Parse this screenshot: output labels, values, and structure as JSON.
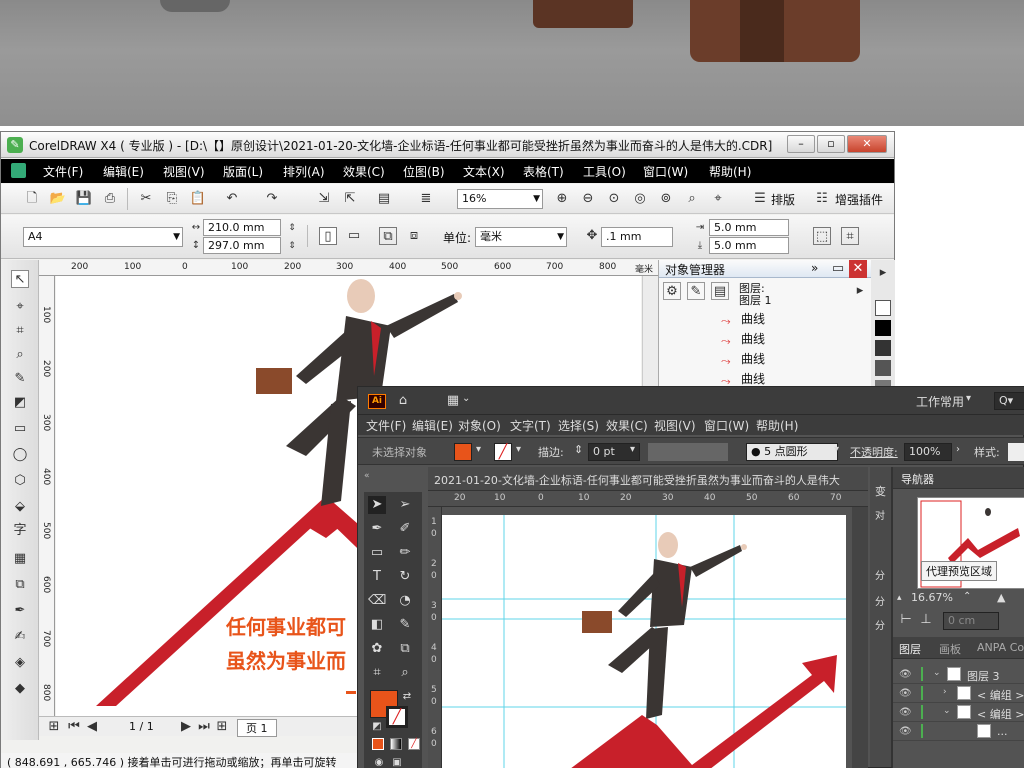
{
  "colors": {
    "brand_red": "#c8202a",
    "suit": "#3a3533",
    "skin": "#e8cbb8",
    "orange": "#e8541a",
    "ai_bg": "#535353",
    "guide": "#5fd4e8"
  },
  "corel": {
    "title": "CorelDRAW X4 ( 专业版 ) - [D:\\【】原创设计\\2021-01-20-文化墙-企业标语-任何事业都可能受挫折虽然为事业而奋斗的人是伟大的.CDR]",
    "menu": [
      "文件(F)",
      "编辑(E)",
      "视图(V)",
      "版面(L)",
      "排列(A)",
      "效果(C)",
      "位图(B)",
      "文本(X)",
      "表格(T)",
      "工具(O)",
      "窗口(W)",
      "帮助(H)"
    ],
    "zoom": "16%",
    "plugin_typeset": "排版",
    "plugin_enhance": "增强插件",
    "page_size": "A4",
    "width": "210.0 mm",
    "height": "297.0 mm",
    "unit_label": "单位:",
    "unit_value": "毫米",
    "nudge": ".1 mm",
    "dup_x": "5.0 mm",
    "dup_y": "5.0 mm",
    "hruler": [
      "200",
      "100",
      "0",
      "100",
      "200",
      "300",
      "400",
      "500",
      "600",
      "700",
      "800"
    ],
    "hruler_unit": "毫米",
    "vruler": [
      "100",
      "200",
      "300",
      "400",
      "500",
      "600",
      "700",
      "800"
    ],
    "page_counter": "1 / 1",
    "page_tab": "页 1",
    "status": "( 848.691 , 665.746 )    接着单击可进行拖动或缩放；再单击可旋转",
    "slogan_line1": "任何事业都可",
    "slogan_line2": "虽然为事业而",
    "objmgr": {
      "title": "对象管理器",
      "layer_line1": "图层:",
      "layer_line2": "图层 1",
      "items": [
        "曲线",
        "曲线",
        "曲线",
        "曲线"
      ]
    }
  },
  "ai": {
    "logo": "Ai",
    "workspace": "工作常用",
    "menu": [
      "文件(F)",
      "编辑(E)",
      "对象(O)",
      "文字(T)",
      "选择(S)",
      "效果(C)",
      "视图(V)",
      "窗口(W)",
      "帮助(H)"
    ],
    "no_selection": "未选择对象",
    "stroke_label": "描边:",
    "stroke_value": "0 pt",
    "brush": "5 点圆形",
    "opacity_label": "不透明度:",
    "opacity_value": "100%",
    "style_label": "样式:",
    "doc_tab": "2021-01-20-文化墙-企业标语-任何事业都可能受挫折虽然为事业而奋斗的人是伟大",
    "hruler": [
      "20",
      "10",
      "0",
      "10",
      "20",
      "30",
      "40",
      "50",
      "60",
      "70"
    ],
    "vruler": [
      "1",
      "0",
      "2",
      "0",
      "3",
      "0",
      "4",
      "0",
      "5",
      "0",
      "6",
      "0"
    ],
    "navigator_tab": "导航器",
    "side_tab": "变",
    "proxy_tooltip": "代理预览区域",
    "nav_zoom": "16.67%",
    "align_value": "0 cm",
    "panel_tabs": [
      "图层",
      "画板",
      "ANPA Color"
    ],
    "layers": [
      {
        "name": "图层 3",
        "indent": 0
      },
      {
        "name": "< 编组 >",
        "indent": 1
      },
      {
        "name": "< 编组 >",
        "indent": 1
      },
      {
        "name": "...",
        "indent": 2
      }
    ],
    "side_labels": [
      "对",
      "分",
      "分",
      "分"
    ]
  }
}
